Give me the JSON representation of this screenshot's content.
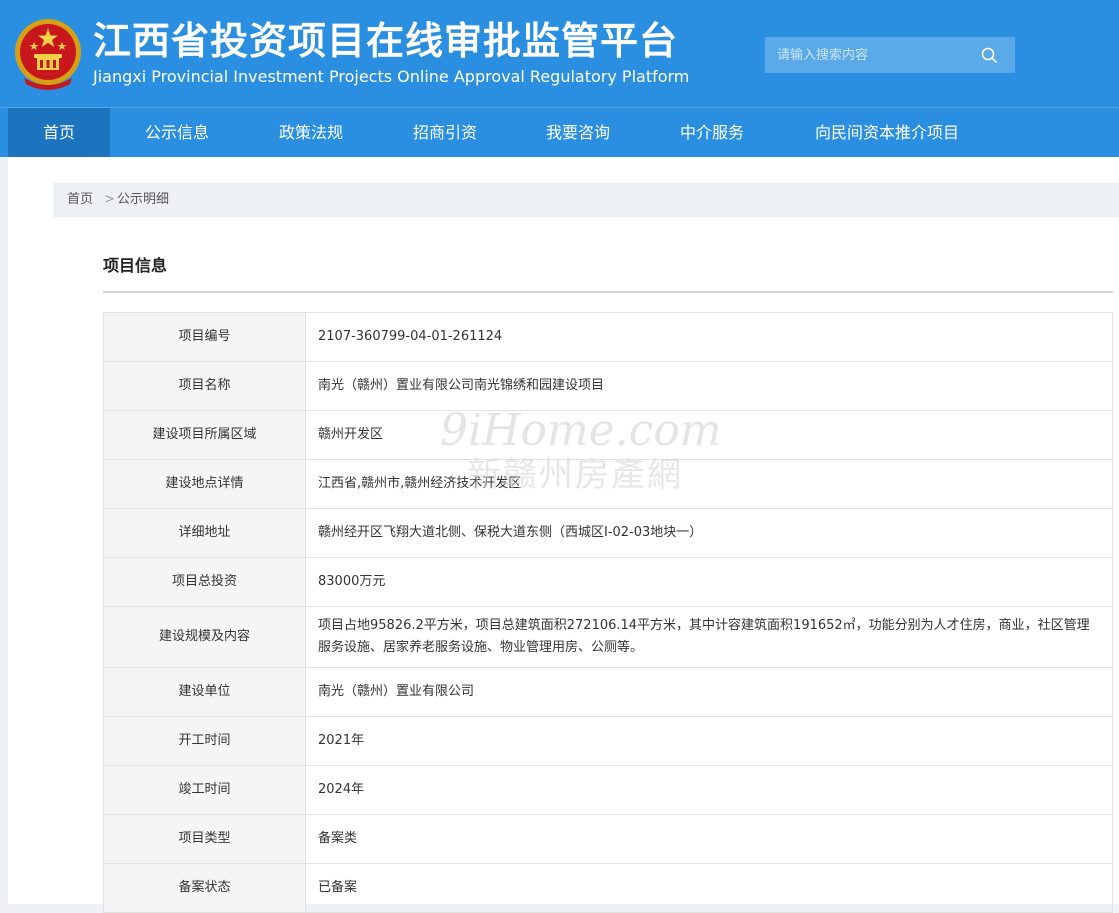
{
  "header": {
    "title_cn": "江西省投资项目在线审批监管平台",
    "title_en": "Jiangxi Provincial Investment Projects Online Approval Regulatory Platform",
    "emblem_icon": "national-emblem-icon",
    "search": {
      "placeholder": "请输入搜索内容",
      "icon": "search-icon"
    },
    "colors": {
      "bar": "#2a8fe0",
      "active_nav": "#1c74bf"
    }
  },
  "nav": {
    "items": [
      {
        "label": "首页",
        "active": true
      },
      {
        "label": "公示信息"
      },
      {
        "label": "政策法规"
      },
      {
        "label": "招商引资"
      },
      {
        "label": "我要咨询"
      },
      {
        "label": "中介服务"
      },
      {
        "label": "向民间资本推介项目"
      }
    ]
  },
  "breadcrumb": {
    "home": "首页",
    "separator": ">",
    "current": "公示明细"
  },
  "section": {
    "title": "项目信息"
  },
  "project_table": {
    "rows": [
      {
        "label": "项目编号",
        "value": "2107-360799-04-01-261124"
      },
      {
        "label": "项目名称",
        "value": "南光（赣州）置业有限公司南光锦绣和园建设项目"
      },
      {
        "label": "建设项目所属区域",
        "value": "赣州开发区"
      },
      {
        "label": "建设地点详情",
        "value": "江西省,赣州市,赣州经济技术开发区"
      },
      {
        "label": "详细地址",
        "value": "赣州经开区飞翔大道北侧、保税大道东侧（西城区I-02-03地块一）"
      },
      {
        "label": "项目总投资",
        "value": "83000万元"
      },
      {
        "label": "建设规模及内容",
        "value": "项目占地95826.2平方米，项目总建筑面积272106.14平方米，其中计容建筑面积191652㎡，功能分别为人才住房，商业，社区管理服务设施、居家养老服务设施、物业管理用房、公厕等。"
      },
      {
        "label": "建设单位",
        "value": "南光（赣州）置业有限公司"
      },
      {
        "label": "开工时间",
        "value": "2021年"
      },
      {
        "label": "竣工时间",
        "value": "2024年"
      },
      {
        "label": "项目类型",
        "value": "备案类"
      },
      {
        "label": "备案状态",
        "value": "已备案"
      }
    ]
  },
  "watermark": {
    "line1": "9iHome.com",
    "line2": "新赣州房產網"
  }
}
